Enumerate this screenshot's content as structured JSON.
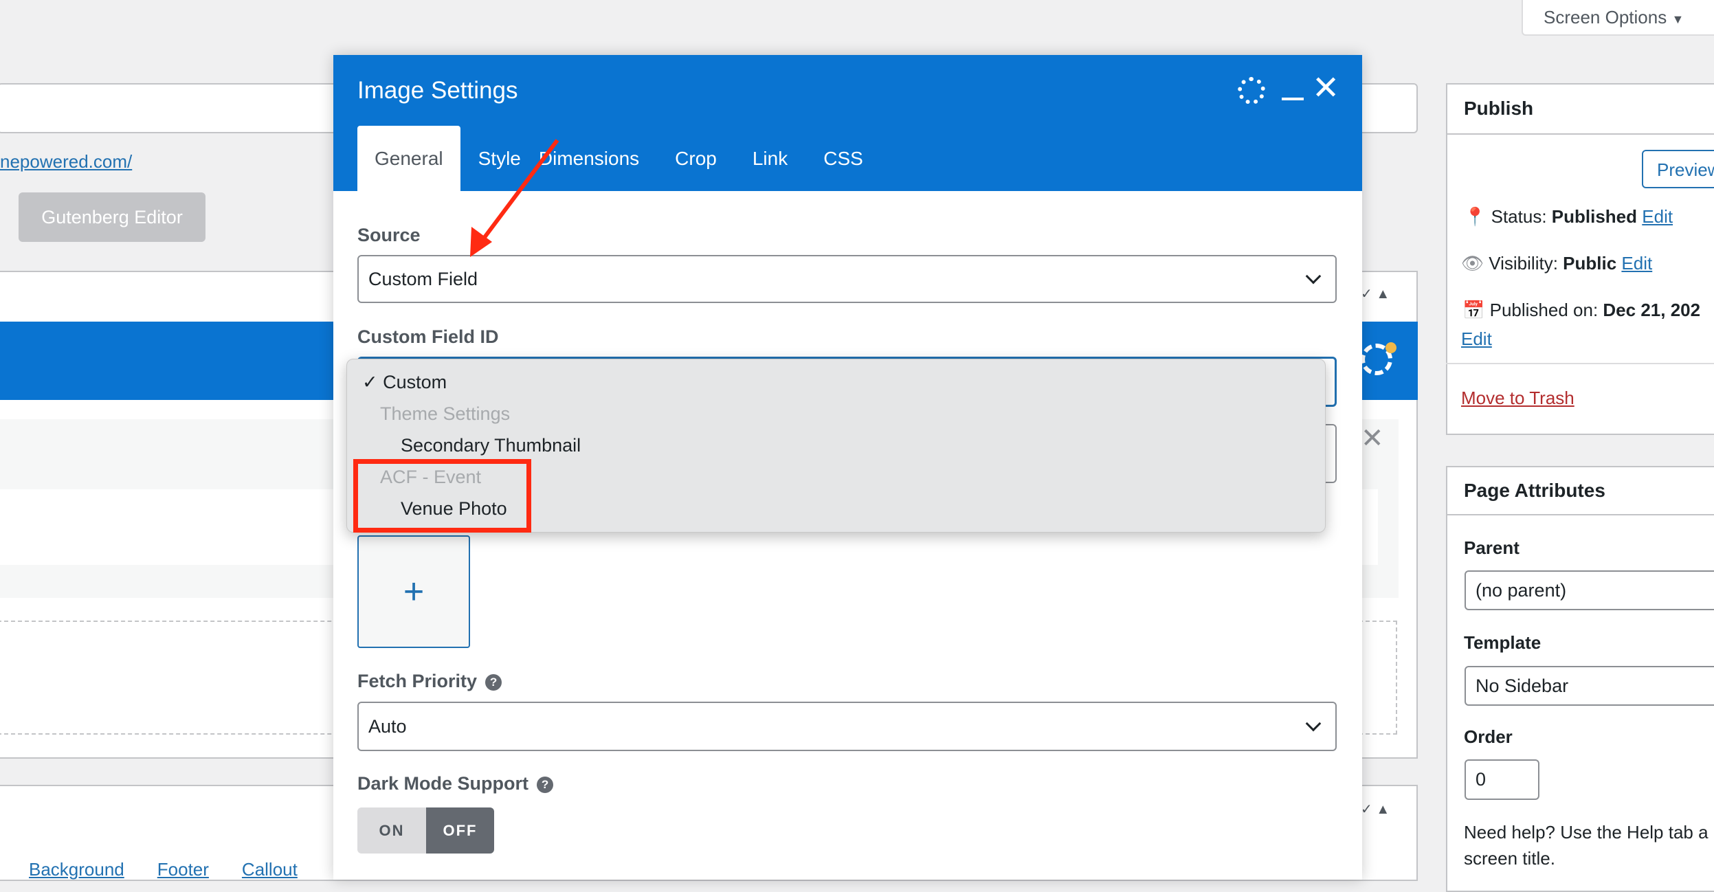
{
  "screen_options": "Screen Options",
  "editor": {
    "permalink": "nepowered.com/",
    "gutenberg_button": "Gutenberg Editor",
    "bottom_links": [
      "Background",
      "Footer",
      "Callout"
    ]
  },
  "modal": {
    "title": "Image Settings",
    "tabs": [
      {
        "label": "General",
        "active": true
      },
      {
        "label": "Style"
      },
      {
        "label": "Dimensions"
      },
      {
        "label": "Crop"
      },
      {
        "label": "Link"
      },
      {
        "label": "CSS"
      }
    ],
    "source_label": "Source",
    "source_value": "Custom Field",
    "custom_field_label": "Custom Field ID",
    "dropdown": [
      {
        "label": "Custom",
        "type": "option",
        "checked": true,
        "check": "✓"
      },
      {
        "label": "Theme Settings",
        "type": "group"
      },
      {
        "label": "Secondary Thumbnail",
        "type": "option"
      },
      {
        "label": "ACF - Event",
        "type": "group"
      },
      {
        "label": "Venue Photo",
        "type": "option"
      }
    ],
    "add_icon": "+",
    "fetch_priority_label": "Fetch Priority",
    "fetch_priority_value": "Auto",
    "dark_mode_label": "Dark Mode Support",
    "toggle_on": "ON",
    "toggle_off": "OFF",
    "dark_mode_state": "OFF",
    "help_glyph": "?",
    "header_color": "#0a74d1",
    "annotation_color": "#ff2a12"
  },
  "publish": {
    "title": "Publish",
    "preview": "Preview",
    "status_label": "Status:",
    "status_value": "Published",
    "visibility_label": "Visibility:",
    "visibility_value": "Public",
    "published_label": "Published on:",
    "published_value": "Dec 21, 202",
    "edit": "Edit",
    "trash": "Move to Trash"
  },
  "attributes": {
    "title": "Page Attributes",
    "parent_label": "Parent",
    "parent_value": "(no parent)",
    "template_label": "Template",
    "template_value": "No Sidebar",
    "order_label": "Order",
    "order_value": "0",
    "help1": "Need help? Use the Help tab a",
    "help2": "screen title."
  }
}
